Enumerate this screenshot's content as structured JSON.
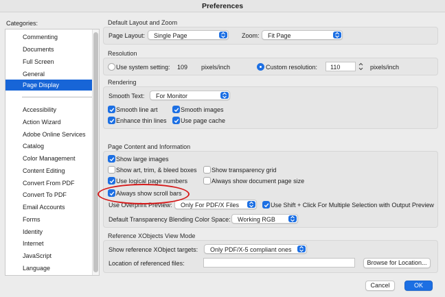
{
  "window": {
    "title": "Preferences"
  },
  "sidebar": {
    "heading": "Categories:",
    "items_top": [
      "Commenting",
      "Documents",
      "Full Screen",
      "General",
      "Page Display"
    ],
    "selected": "Page Display",
    "items_bottom": [
      "Accessibility",
      "Action Wizard",
      "Adobe Online Services",
      "Catalog",
      "Color Management",
      "Content Editing",
      "Convert From PDF",
      "Convert To PDF",
      "Email Accounts",
      "Forms",
      "Identity",
      "Internet",
      "JavaScript",
      "Language"
    ]
  },
  "layout_zoom": {
    "title": "Default Layout and Zoom",
    "page_layout_label": "Page Layout:",
    "page_layout_value": "Single Page",
    "zoom_label": "Zoom:",
    "zoom_value": "Fit Page"
  },
  "resolution": {
    "title": "Resolution",
    "system_label": "Use system setting:",
    "system_value": "109",
    "system_unit": "pixels/inch",
    "custom_label": "Custom resolution:",
    "custom_value": "110",
    "custom_unit": "pixels/inch",
    "selected": "custom"
  },
  "rendering": {
    "title": "Rendering",
    "smooth_text_label": "Smooth Text:",
    "smooth_text_value": "For Monitor",
    "smooth_line_art": "Smooth line art",
    "smooth_images": "Smooth images",
    "enhance_thin_lines": "Enhance thin lines",
    "use_page_cache": "Use page cache"
  },
  "page_content": {
    "title": "Page Content and Information",
    "show_large_images": "Show large images",
    "show_art_trim": "Show art, trim, & bleed boxes",
    "show_transparency_grid": "Show transparency grid",
    "use_logical_page_numbers": "Use logical page numbers",
    "always_show_doc_page_size": "Always show document page size",
    "always_show_scroll_bars": "Always show scroll bars",
    "overprint_label": "Use Overprint Preview:",
    "overprint_value": "Only For PDF/X Files",
    "shift_click": "Use Shift + Click For Multiple Selection with Output Preview",
    "blending_label": "Default Transparency Blending Color Space:",
    "blending_value": "Working RGB"
  },
  "xobjects": {
    "title": "Reference XObjects View Mode",
    "show_targets_label": "Show reference XObject targets:",
    "show_targets_value": "Only PDF/X-5 compliant ones",
    "location_label": "Location of referenced files:",
    "location_value": "",
    "browse_label": "Browse for Location..."
  },
  "footer": {
    "cancel": "Cancel",
    "ok": "OK"
  },
  "colors": {
    "accent": "#1c6fe3",
    "selection": "#1765d7",
    "highlight_ring": "#d61a1a"
  },
  "icons": {
    "checkmark": "checkmark-icon",
    "popup": "chevron-updown-icon"
  }
}
